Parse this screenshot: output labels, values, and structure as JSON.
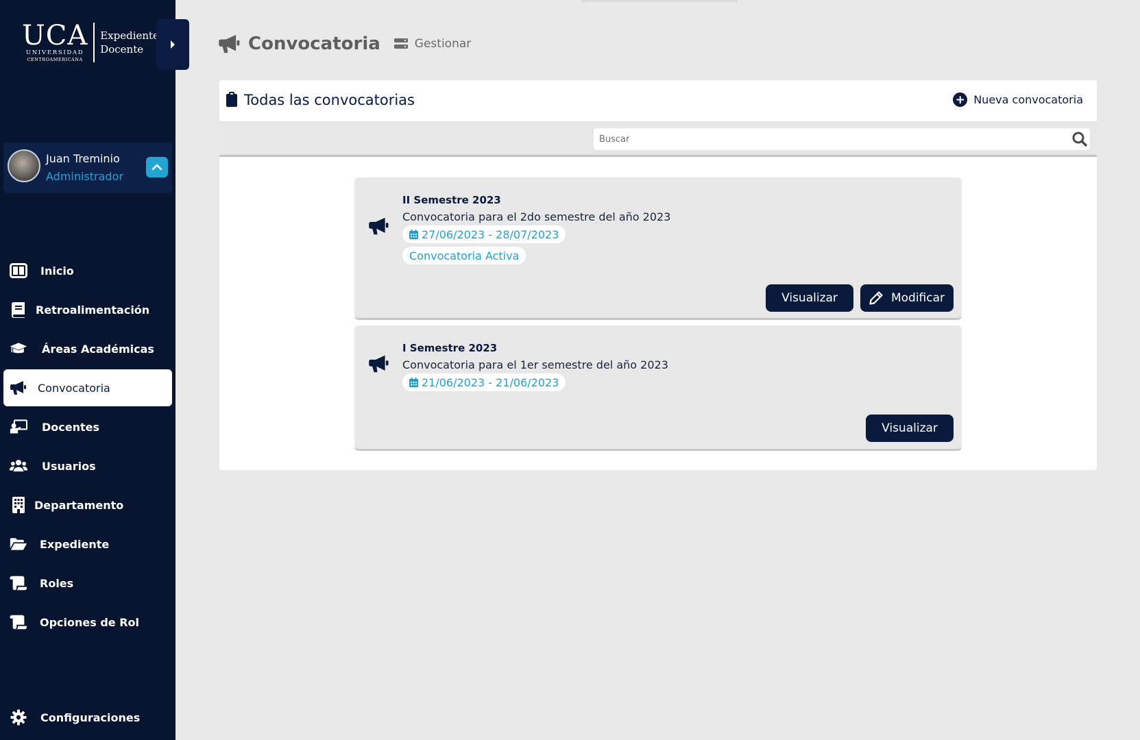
{
  "brand": {
    "logo_main": "UCA",
    "logo_line1": "UNIVERSIDAD",
    "logo_line2": "CENTROAMERICANA",
    "app_line1": "Expediente",
    "app_line2": "Docente"
  },
  "user": {
    "name": "Juan Treminio",
    "role": "Administrador"
  },
  "sidebar": {
    "items": [
      {
        "label": "Inicio",
        "icon": "columns-icon"
      },
      {
        "label": "Retroalimentación",
        "icon": "book-icon"
      },
      {
        "label": "Áreas Académicas",
        "icon": "graduation-cap-icon"
      },
      {
        "label": "Convocatoria",
        "icon": "megaphone-icon",
        "active": true
      },
      {
        "label": "Docentes",
        "icon": "chalkboard-teacher-icon"
      },
      {
        "label": "Usuarios",
        "icon": "users-icon"
      },
      {
        "label": "Departamento",
        "icon": "building-icon"
      },
      {
        "label": "Expediente",
        "icon": "folder-open-icon"
      },
      {
        "label": "Roles",
        "icon": "scroll-icon"
      },
      {
        "label": "Opciones de Rol",
        "icon": "scroll-icon"
      }
    ],
    "config_label": "Configuraciones"
  },
  "header": {
    "title": "Convocatoria",
    "subtitle": "Gestionar"
  },
  "panel": {
    "title": "Todas las convocatorias",
    "new_label": "Nueva convocatoria",
    "search_placeholder": "Buscar"
  },
  "cards": [
    {
      "title": "II Semestre 2023",
      "description": "Convocatoria para el 2do semestre del año 2023",
      "dates": "27/06/2023 - 28/07/2023",
      "status": "Convocatoria Activa",
      "view_label": "Visualizar",
      "edit_label": "Modificar"
    },
    {
      "title": "I Semestre 2023",
      "description": "Convocatoria para el 1er semestre del año 2023",
      "dates": "21/06/2023 - 21/06/2023",
      "view_label": "Visualizar"
    }
  ],
  "colors": {
    "sidebar_bg": "#081530",
    "primary": "#0a1a3c",
    "accent": "#21a6d4",
    "page_bg": "#e9e9e9"
  }
}
